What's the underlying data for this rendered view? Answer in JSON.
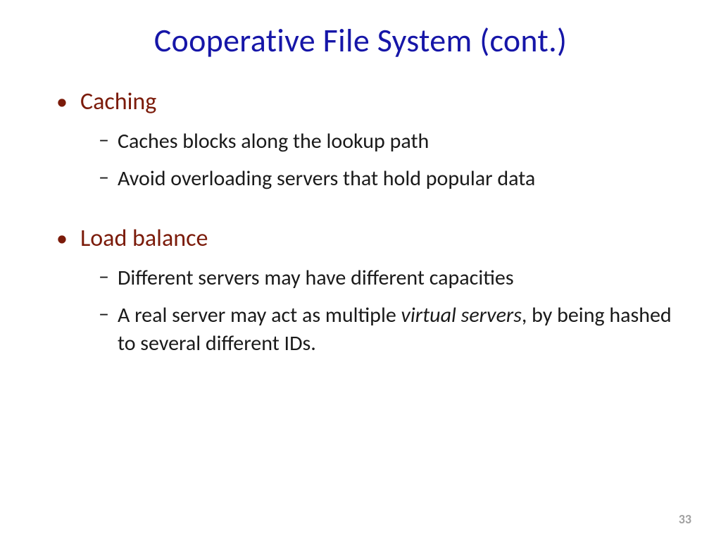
{
  "title": "Cooperative File System (cont.)",
  "topics": [
    {
      "title": "Caching",
      "subs": [
        {
          "pre": "Caches blocks along the lookup path",
          "italic": "",
          "post": ""
        },
        {
          "pre": "Avoid overloading servers that hold popular data",
          "italic": "",
          "post": ""
        }
      ]
    },
    {
      "title": "Load balance",
      "subs": [
        {
          "pre": "Different servers may have different capacities",
          "italic": "",
          "post": ""
        },
        {
          "pre": "A real server may act as multiple ",
          "italic": "virtual servers",
          "post": ", by being hashed to several different IDs."
        }
      ]
    }
  ],
  "bullets": {
    "l1": "•",
    "l2": "–"
  },
  "pageNumber": "33"
}
